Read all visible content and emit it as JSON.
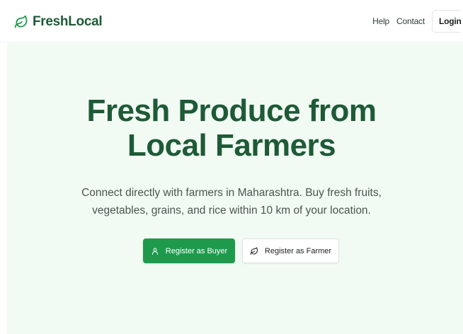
{
  "brand": {
    "name": "FreshLocal",
    "logo_icon": "leaf-icon",
    "color": "#1e5a36"
  },
  "nav": {
    "help": "Help",
    "contact": "Contact",
    "login": "Login"
  },
  "hero": {
    "headline_line1": "Fresh Produce from",
    "headline_line2": "Local Farmers",
    "subtext_line1": "Connect directly with farmers in Maharashtra. Buy fresh fruits,",
    "subtext_line2": "vegetables, grains, and rice within 10 km of your location.",
    "background": "#f1faf3"
  },
  "cta": {
    "buyer_label": "Register as Buyer",
    "buyer_icon": "user-icon",
    "buyer_color": "#1f9a4c",
    "farmer_label": "Register as Farmer",
    "farmer_icon": "leaf-icon"
  }
}
